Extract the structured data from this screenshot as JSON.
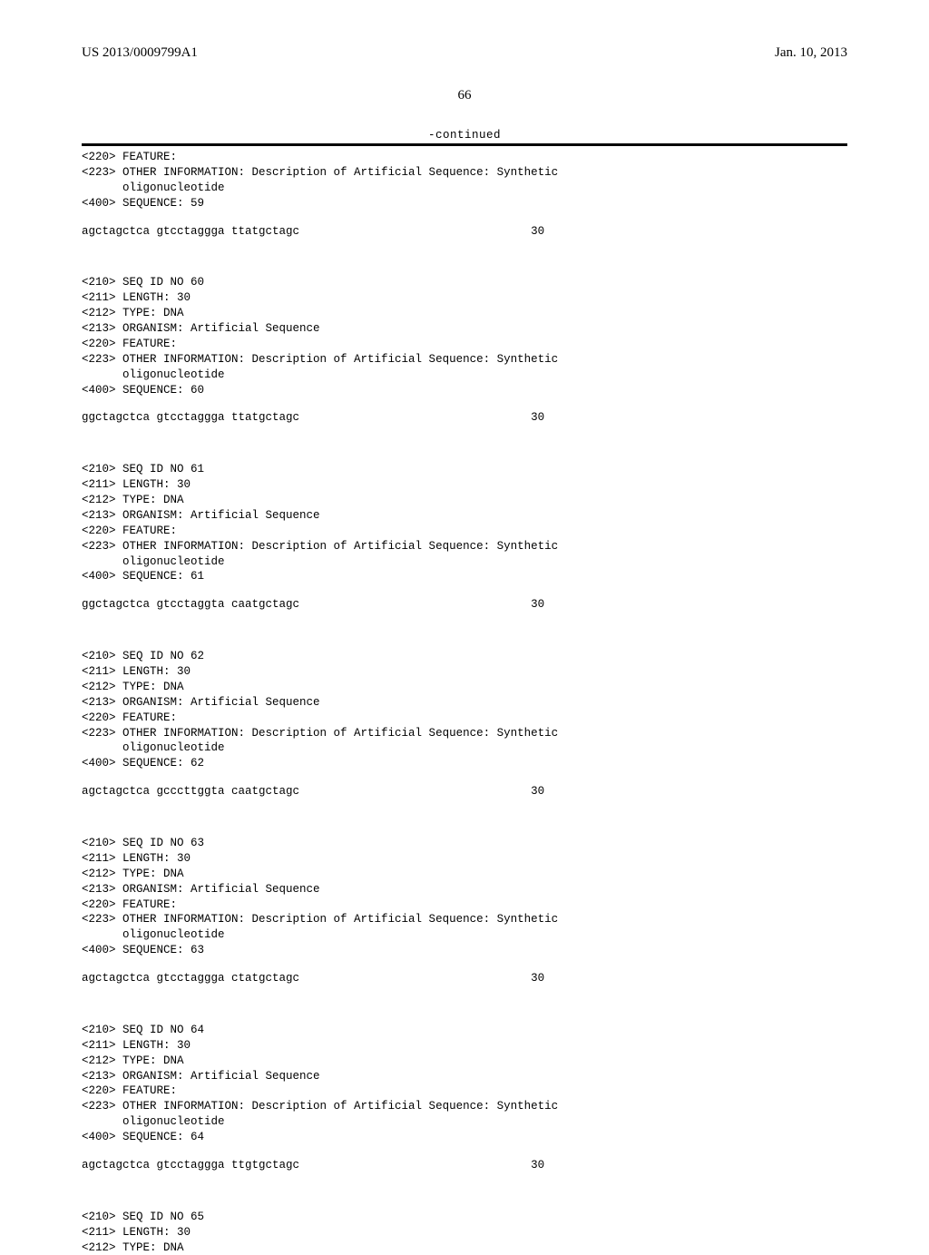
{
  "header": {
    "pub_number": "US 2013/0009799A1",
    "date": "Jan. 10, 2013"
  },
  "page_number": "66",
  "continued_label": "-continued",
  "entries": [
    {
      "pre_lines": [
        "<220> FEATURE:",
        "<223> OTHER INFORMATION: Description of Artificial Sequence: Synthetic",
        "      oligonucleotide",
        "",
        "<400> SEQUENCE: 59"
      ],
      "sequence": "agctagctca gtcctaggga ttatgctagc",
      "length": "30"
    },
    {
      "pre_lines": [
        "<210> SEQ ID NO 60",
        "<211> LENGTH: 30",
        "<212> TYPE: DNA",
        "<213> ORGANISM: Artificial Sequence",
        "<220> FEATURE:",
        "<223> OTHER INFORMATION: Description of Artificial Sequence: Synthetic",
        "      oligonucleotide",
        "",
        "<400> SEQUENCE: 60"
      ],
      "sequence": "ggctagctca gtcctaggga ttatgctagc",
      "length": "30"
    },
    {
      "pre_lines": [
        "<210> SEQ ID NO 61",
        "<211> LENGTH: 30",
        "<212> TYPE: DNA",
        "<213> ORGANISM: Artificial Sequence",
        "<220> FEATURE:",
        "<223> OTHER INFORMATION: Description of Artificial Sequence: Synthetic",
        "      oligonucleotide",
        "",
        "<400> SEQUENCE: 61"
      ],
      "sequence": "ggctagctca gtcctaggta caatgctagc",
      "length": "30"
    },
    {
      "pre_lines": [
        "<210> SEQ ID NO 62",
        "<211> LENGTH: 30",
        "<212> TYPE: DNA",
        "<213> ORGANISM: Artificial Sequence",
        "<220> FEATURE:",
        "<223> OTHER INFORMATION: Description of Artificial Sequence: Synthetic",
        "      oligonucleotide",
        "",
        "<400> SEQUENCE: 62"
      ],
      "sequence": "agctagctca gcccttggta caatgctagc",
      "length": "30"
    },
    {
      "pre_lines": [
        "<210> SEQ ID NO 63",
        "<211> LENGTH: 30",
        "<212> TYPE: DNA",
        "<213> ORGANISM: Artificial Sequence",
        "<220> FEATURE:",
        "<223> OTHER INFORMATION: Description of Artificial Sequence: Synthetic",
        "      oligonucleotide",
        "",
        "<400> SEQUENCE: 63"
      ],
      "sequence": "agctagctca gtcctaggga ctatgctagc",
      "length": "30"
    },
    {
      "pre_lines": [
        "<210> SEQ ID NO 64",
        "<211> LENGTH: 30",
        "<212> TYPE: DNA",
        "<213> ORGANISM: Artificial Sequence",
        "<220> FEATURE:",
        "<223> OTHER INFORMATION: Description of Artificial Sequence: Synthetic",
        "      oligonucleotide",
        "",
        "<400> SEQUENCE: 64"
      ],
      "sequence": "agctagctca gtcctaggga ttgtgctagc",
      "length": "30"
    }
  ],
  "trailing_lines": [
    "<210> SEQ ID NO 65",
    "<211> LENGTH: 30",
    "<212> TYPE: DNA"
  ]
}
